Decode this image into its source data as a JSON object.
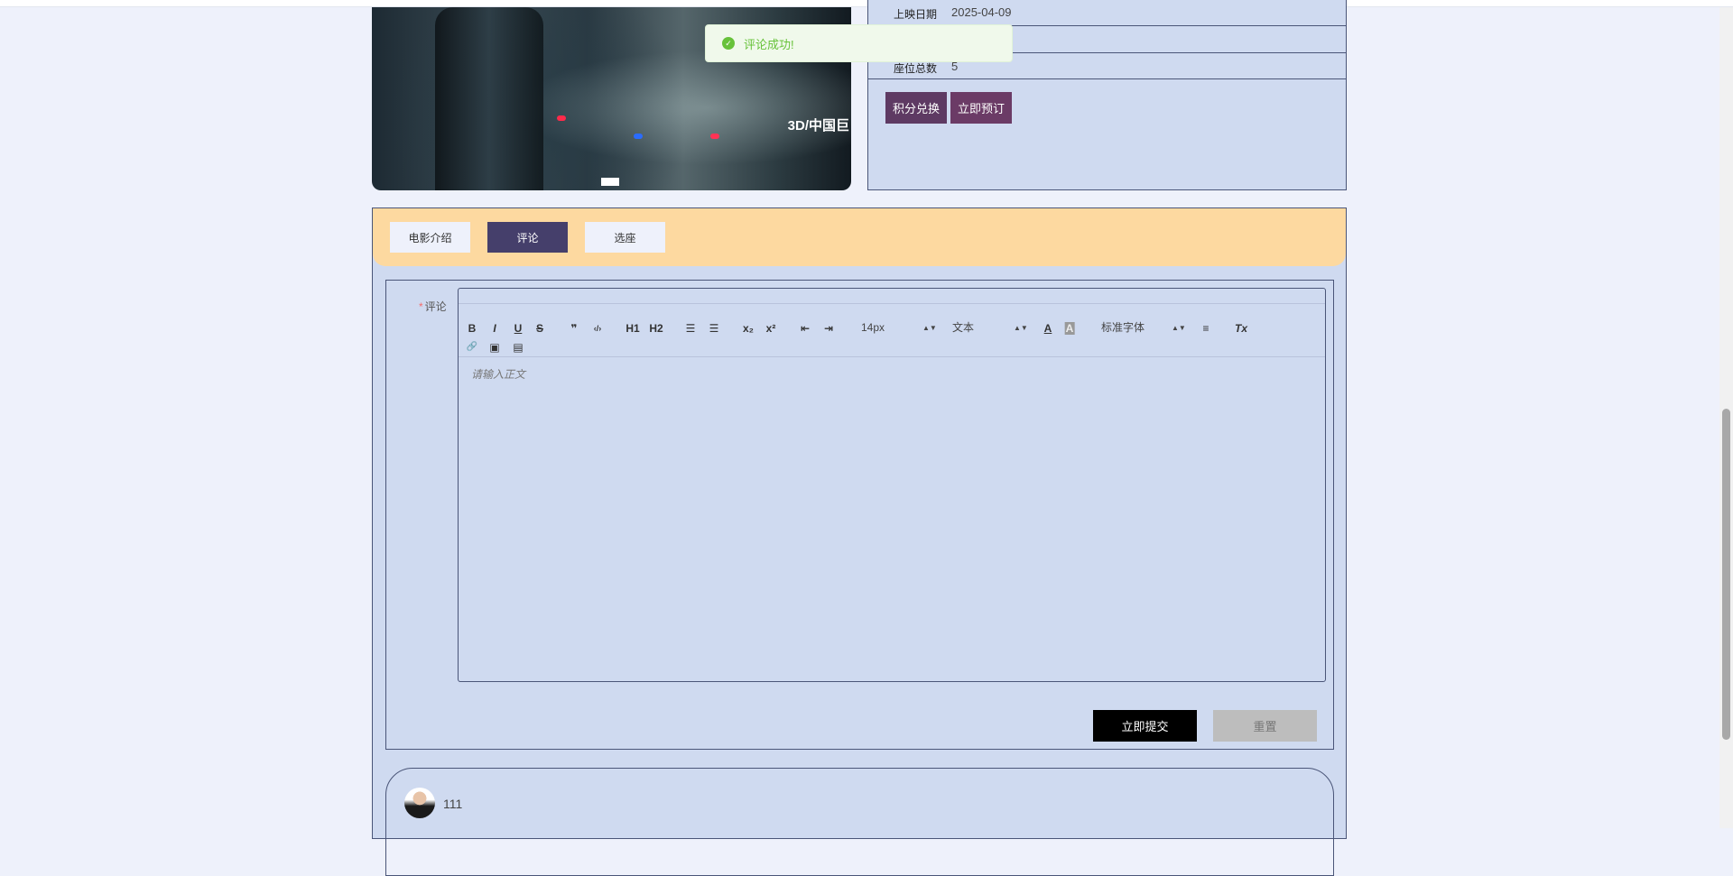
{
  "movie": {
    "poster_text": "3D/中国巨",
    "info": [
      {
        "label": "上映日期",
        "value": "2025-04-09"
      },
      {
        "label": "",
        "value": ""
      },
      {
        "label": "座位总数",
        "value": "5"
      }
    ],
    "buttons": {
      "points_exchange": "积分兑换",
      "book_now": "立即预订"
    },
    "accent": "#5e3a63"
  },
  "toast": {
    "message": "评论成功!",
    "type": "success",
    "color": "#67c23a"
  },
  "tabs": [
    {
      "label": "电影介绍",
      "active": false
    },
    {
      "label": "评论",
      "active": true
    },
    {
      "label": "选座",
      "active": false
    }
  ],
  "form": {
    "label": "评论",
    "required_mark": "*",
    "toolbar": {
      "bold": "B",
      "italic": "I",
      "underline": "U",
      "strike": "S",
      "blockquote": "❞",
      "code": "‹/›",
      "h1": "H1",
      "h2": "H2",
      "ordered_list": "☰",
      "bullet_list": "☰",
      "subscript": "x₂",
      "superscript": "x²",
      "outdent": "⇤",
      "indent": "⇥",
      "size": "14px",
      "header": "文本",
      "color": "A",
      "background": "A",
      "font": "标准字体",
      "align": "≡",
      "clean": "Tx",
      "link": "🔗",
      "image": "▣",
      "video": "▤"
    },
    "placeholder": "请输入正文",
    "submit": "立即提交",
    "reset": "重置"
  },
  "comments": [
    {
      "user": "111"
    }
  ]
}
